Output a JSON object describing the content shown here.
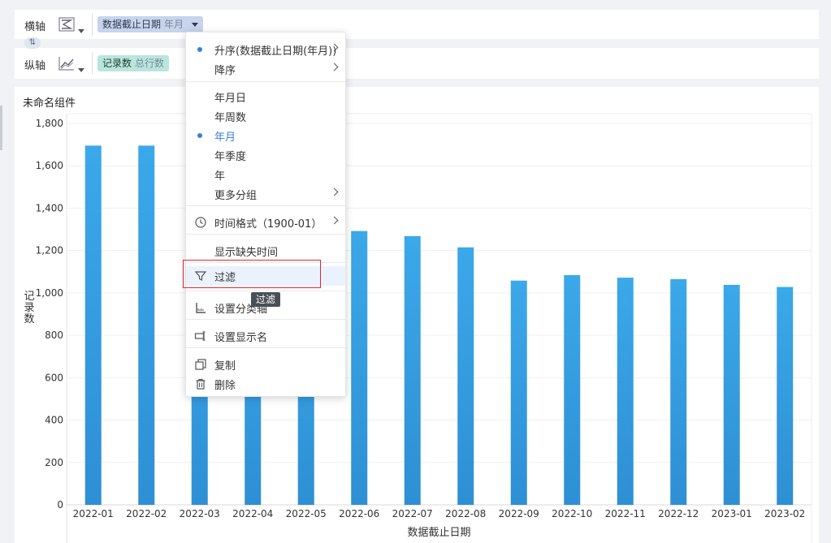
{
  "axes": {
    "x_label": "横轴",
    "y_label": "纵轴",
    "x_pill": {
      "name": "数据截止日期",
      "sub": "年月"
    },
    "y_pill": {
      "name": "记录数",
      "sub": "总行数"
    },
    "swap_icon": "swap-arrows-icon"
  },
  "widget": {
    "title": "未命名组件"
  },
  "chart_data": {
    "type": "bar",
    "categories": [
      "2022-01",
      "2022-02",
      "2022-03",
      "2022-04",
      "2022-05",
      "2022-06",
      "2022-07",
      "2022-08",
      "2022-09",
      "2022-10",
      "2022-11",
      "2022-12",
      "2023-01",
      "2023-02"
    ],
    "values": [
      1695,
      1695,
      1240,
      1190,
      1150,
      1292,
      1268,
      1215,
      1058,
      1084,
      1072,
      1065,
      1038,
      1028
    ],
    "xlabel": "数据截止日期",
    "ylabel": "记录数",
    "ylim": [
      0,
      1800
    ],
    "yticks": [
      "0",
      "200",
      "400",
      "600",
      "800",
      "1,000",
      "1,200",
      "1,400",
      "1,600",
      "1,800"
    ],
    "bar_color": "#3aa0e4",
    "grid": true
  },
  "menu": {
    "items": [
      {
        "label": "升序(数据截止日期(年月))",
        "dot": true,
        "arrow": true
      },
      {
        "label": "降序",
        "arrow": true
      },
      {
        "label": "年月日"
      },
      {
        "label": "年周数"
      },
      {
        "label": "年月",
        "dot": true,
        "active": true
      },
      {
        "label": "年季度"
      },
      {
        "label": "年"
      },
      {
        "label": "更多分组",
        "arrow": true
      },
      {
        "label": "时间格式（1900-01）",
        "icon": "clock-icon",
        "arrow": true
      },
      {
        "label": "显示缺失时间"
      },
      {
        "label": "过滤",
        "icon": "filter-icon",
        "hover": true
      },
      {
        "label": "设置分类轴",
        "icon": "ruler-icon"
      },
      {
        "label": "设置显示名",
        "icon": "rename-icon"
      },
      {
        "label": "复制",
        "icon": "copy-icon"
      },
      {
        "label": "删除",
        "icon": "trash-icon"
      }
    ]
  },
  "tooltip": {
    "text": "过滤"
  },
  "colors": {
    "accent": "#3a7fd5",
    "highlight_border": "#e0262e",
    "bar": "#3aa0e4"
  }
}
